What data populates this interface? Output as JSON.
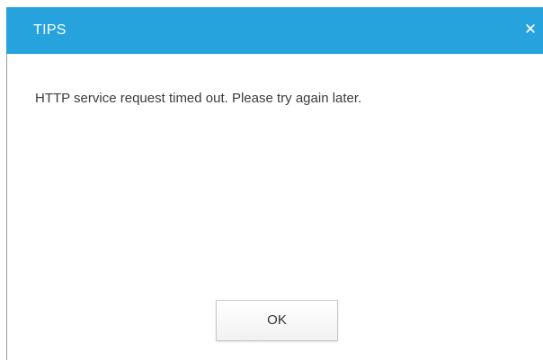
{
  "dialog": {
    "title": "TIPS",
    "close_icon": "close-icon",
    "close_glyph": "✕",
    "message": "HTTP service request timed out. Please try again later.",
    "ok_label": "OK"
  },
  "colors": {
    "titlebar": "#26a3dc",
    "title_text": "#ffffff",
    "message_text": "#3b3b3b",
    "border": "#9a9a9a"
  }
}
